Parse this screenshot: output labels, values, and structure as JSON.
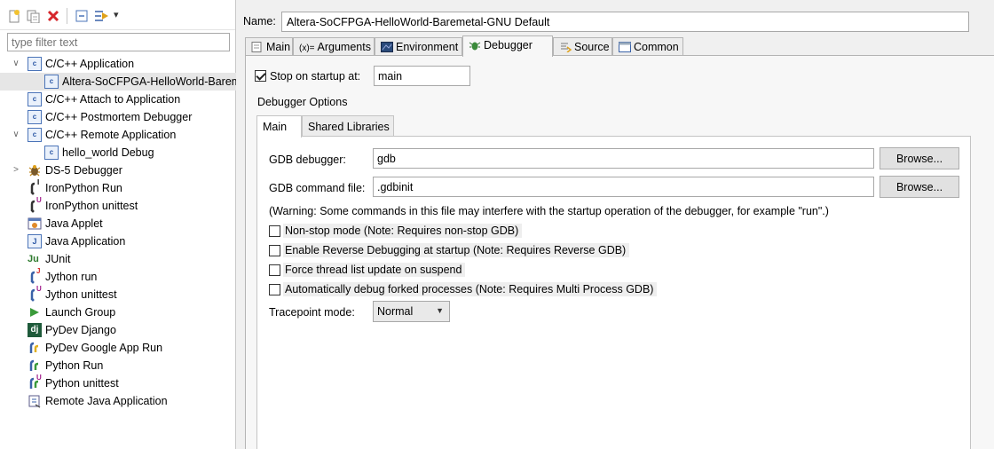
{
  "sidebar": {
    "filter_placeholder": "type filter text",
    "toolbar": {
      "new_icon": "new-config-icon",
      "duplicate_icon": "duplicate-icon",
      "delete_icon": "delete-icon",
      "collapse_icon": "collapse-all-icon",
      "filter_icon": "filter-icon",
      "menu_icon": "view-menu-chevron-icon",
      "menu_glyph": "▾"
    },
    "tree": [
      {
        "label": "C/C++ Application",
        "level": 0,
        "expanded": true,
        "icon": "c-icon"
      },
      {
        "label": "Altera-SoCFPGA-HelloWorld-Baremetal-GNU Default",
        "level": 1,
        "selected": true,
        "icon": "c-icon"
      },
      {
        "label": "C/C++ Attach to Application",
        "level": 0,
        "icon": "c-icon"
      },
      {
        "label": "C/C++ Postmortem Debugger",
        "level": 0,
        "icon": "c-icon"
      },
      {
        "label": "C/C++ Remote Application",
        "level": 0,
        "expanded": true,
        "icon": "c-icon"
      },
      {
        "label": "hello_world Debug",
        "level": 1,
        "icon": "c-icon"
      },
      {
        "label": "DS-5 Debugger",
        "level": 0,
        "collapsed": true,
        "icon": "bug-icon"
      },
      {
        "label": "IronPython Run",
        "level": 0,
        "icon": "ironpython-icon"
      },
      {
        "label": "IronPython unittest",
        "level": 0,
        "icon": "ironpython-unittest-icon"
      },
      {
        "label": "Java Applet",
        "level": 0,
        "icon": "applet-icon"
      },
      {
        "label": "Java Application",
        "level": 0,
        "icon": "java-app-icon"
      },
      {
        "label": "JUnit",
        "level": 0,
        "icon": "junit-icon"
      },
      {
        "label": "Jython run",
        "level": 0,
        "icon": "jython-icon"
      },
      {
        "label": "Jython unittest",
        "level": 0,
        "icon": "jython-unittest-icon"
      },
      {
        "label": "Launch Group",
        "level": 0,
        "icon": "launch-group-icon"
      },
      {
        "label": "PyDev Django",
        "level": 0,
        "icon": "django-icon"
      },
      {
        "label": "PyDev Google App Run",
        "level": 0,
        "icon": "google-app-icon"
      },
      {
        "label": "Python Run",
        "level": 0,
        "icon": "python-icon"
      },
      {
        "label": "Python unittest",
        "level": 0,
        "icon": "python-unittest-icon"
      },
      {
        "label": "Remote Java Application",
        "level": 0,
        "icon": "remote-java-icon"
      }
    ],
    "glyphs": {
      "expanded": "∨",
      "collapsed": ">",
      "c": "c",
      "junit": "Ju",
      "django": "dj",
      "superscript_i": "I",
      "superscript_u": "U",
      "superscript_j": "J"
    }
  },
  "editor": {
    "name_label": "Name:",
    "name_value": "Altera-SoCFPGA-HelloWorld-Baremetal-GNU Default",
    "tabs": [
      {
        "label": "Main",
        "icon": "main-tab-icon"
      },
      {
        "label": "Arguments",
        "icon": "arguments-icon",
        "glyph": "(x)="
      },
      {
        "label": "Environment",
        "icon": "environment-icon"
      },
      {
        "label": "Debugger",
        "icon": "debugger-icon",
        "active": true
      },
      {
        "label": "Source",
        "icon": "source-icon"
      },
      {
        "label": "Common",
        "icon": "common-icon"
      }
    ],
    "stop_on_startup": {
      "label": "Stop on startup at:",
      "checked": true,
      "value": "main"
    },
    "debugger_options_label": "Debugger Options",
    "inner_tabs": [
      {
        "label": "Main",
        "active": true
      },
      {
        "label": "Shared Libraries"
      }
    ],
    "gdb_debugger": {
      "label": "GDB debugger:",
      "value": "gdb",
      "browse": "Browse..."
    },
    "gdb_command_file": {
      "label": "GDB command file:",
      "value": ".gdbinit",
      "browse": "Browse..."
    },
    "warning": "(Warning: Some commands in this file may interfere with the startup operation of the debugger, for example \"run\".)",
    "options": [
      {
        "label": "Non-stop mode (Note: Requires non-stop GDB)",
        "checked": false
      },
      {
        "label": "Enable Reverse Debugging at startup (Note: Requires Reverse GDB)",
        "checked": false
      },
      {
        "label": "Force thread list update on suspend",
        "checked": false
      },
      {
        "label": "Automatically debug forked processes (Note: Requires Multi Process GDB)",
        "checked": false
      }
    ],
    "tracepoint": {
      "label": "Tracepoint mode:",
      "value": "Normal",
      "arrow": "▼"
    }
  },
  "colors": {
    "selection": "#e6e6e6",
    "accent_blue": "#2e5aa6",
    "panel_bg": "#f7f7f7"
  }
}
